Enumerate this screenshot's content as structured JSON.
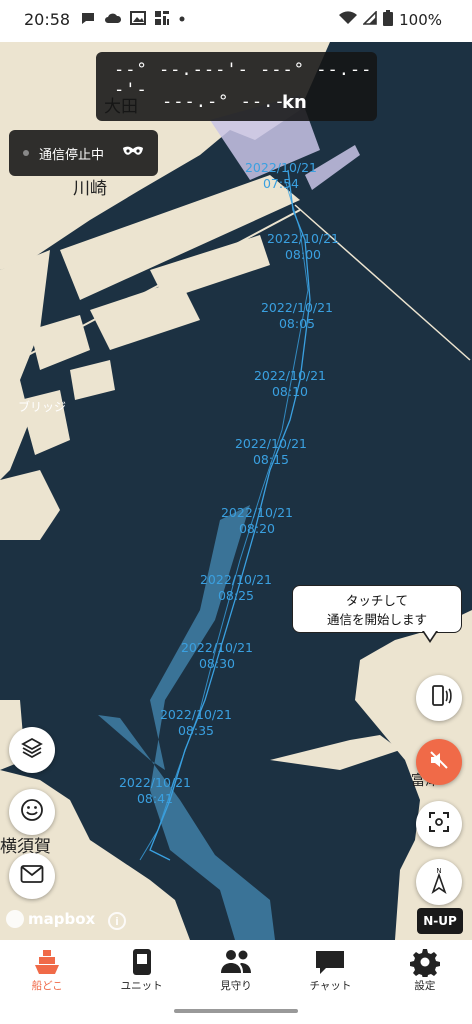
{
  "status_bar": {
    "time": "20:58",
    "battery": "100%",
    "left_icons": [
      "chat-bubble-icon",
      "cloud-icon",
      "gallery-icon",
      "app-icon",
      "dot-icon"
    ],
    "right_icons": [
      "wifi-icon",
      "signal-icon",
      "battery-icon"
    ]
  },
  "gps": {
    "latlon": "--° --.---'- ---° --.---'-",
    "speed": "---.-° --.-",
    "speed_unit": "kn"
  },
  "comm_status": {
    "label": "通信停止中",
    "icon": "mask-icon"
  },
  "map": {
    "places": [
      "大田",
      "川崎",
      "横須賀",
      "富津",
      "ブリッジ"
    ],
    "track_labels": [
      {
        "date": "2022/10/21",
        "time": "07:54"
      },
      {
        "date": "2022/10/21",
        "time": "08:00"
      },
      {
        "date": "2022/10/21",
        "time": "08:05"
      },
      {
        "date": "2022/10/21",
        "time": "08:10"
      },
      {
        "date": "2022/10/21",
        "time": "08:15"
      },
      {
        "date": "2022/10/21",
        "time": "08:20"
      },
      {
        "date": "2022/10/21",
        "time": "08:25"
      },
      {
        "date": "2022/10/21",
        "time": "08:30"
      },
      {
        "date": "2022/10/21",
        "time": "08:35"
      },
      {
        "date": "2022/10/21",
        "time": "08:41"
      }
    ],
    "attribution": "mapbox",
    "orientation_badge": "N-UP"
  },
  "tooltip": {
    "line1": "タッチして",
    "line2": "通信を開始します"
  },
  "map_buttons": {
    "left": [
      "layers-icon",
      "smiley-icon",
      "mail-icon"
    ],
    "right": [
      "phone-vibrate-icon",
      "mute-icon",
      "focus-icon",
      "compass-icon"
    ]
  },
  "bottom_nav": {
    "items": [
      {
        "label": "船どこ",
        "icon": "ship-icon",
        "active": true
      },
      {
        "label": "ユニット",
        "icon": "unit-icon",
        "active": false
      },
      {
        "label": "見守り",
        "icon": "people-icon",
        "active": false
      },
      {
        "label": "チャット",
        "icon": "chat-icon",
        "active": false
      },
      {
        "label": "設定",
        "icon": "gear-icon",
        "active": false
      }
    ]
  },
  "colors": {
    "water": "#1c3142",
    "land": "#ece4d0",
    "track": "#3aa0e0",
    "accent": "#f06a48",
    "channel": "#3f7fa6"
  }
}
